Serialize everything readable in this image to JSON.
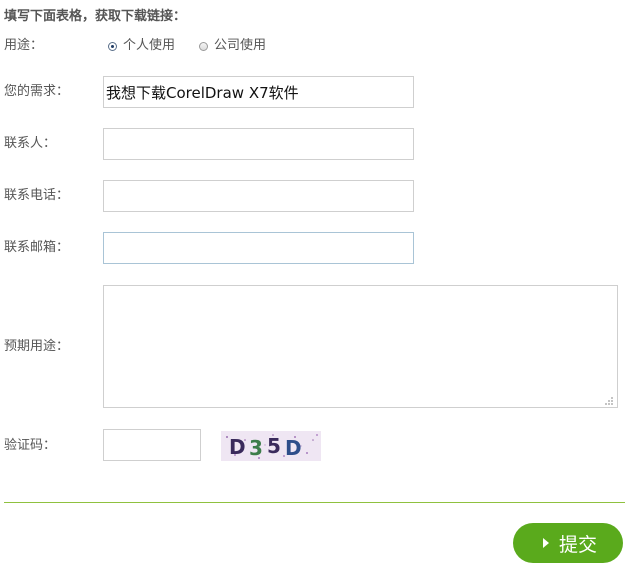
{
  "form": {
    "title": "填写下面表格，获取下载链接：",
    "usage": {
      "label": "用途：",
      "options": [
        "个人使用",
        "公司使用"
      ],
      "selected": "个人使用"
    },
    "need": {
      "label": "您的需求：",
      "value": "我想下载CorelDraw X7软件"
    },
    "contact": {
      "label": "联系人：",
      "value": ""
    },
    "phone": {
      "label": "联系电话：",
      "value": ""
    },
    "email": {
      "label": "联系邮箱：",
      "value": ""
    },
    "purpose": {
      "label": "预期用途：",
      "value": ""
    },
    "captcha": {
      "label": "验证码：",
      "value": "",
      "code": "D35D"
    },
    "submit_label": "提交"
  },
  "colors": {
    "accent": "#5aaa1c",
    "divider": "#8fc13f",
    "text": "#555555"
  }
}
